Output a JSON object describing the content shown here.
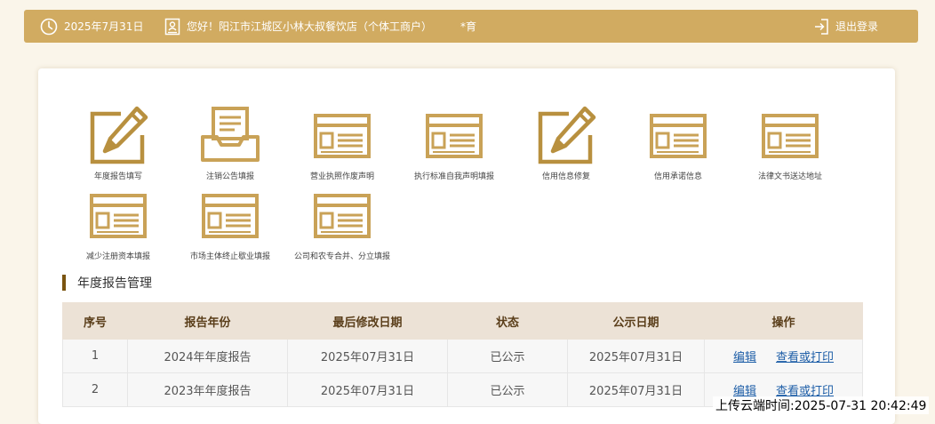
{
  "header": {
    "date": "2025年7月31日",
    "greeting": "您好！阳江市江城区小林大叔餐饮店（个体工商户）",
    "user": "*育",
    "logout_label": "退出登录"
  },
  "tiles": [
    {
      "label": "年度报告填写",
      "icon": "pencil-form-icon"
    },
    {
      "label": "注销公告填报",
      "icon": "inbox-tray-icon"
    },
    {
      "label": "营业执照作废声明",
      "icon": "document-window-icon"
    },
    {
      "label": "执行标准自我声明填报",
      "icon": "document-window-icon"
    },
    {
      "label": "信用信息修复",
      "icon": "pencil-form-icon"
    },
    {
      "label": "信用承诺信息",
      "icon": "document-window-icon"
    },
    {
      "label": "法律文书送达地址",
      "icon": "document-window-icon"
    },
    {
      "label": "减少注册资本填报",
      "icon": "document-window-icon"
    },
    {
      "label": "市场主体终止歇业填报",
      "icon": "document-window-icon"
    },
    {
      "label": "公司和农专合并、分立填报",
      "icon": "document-window-icon"
    }
  ],
  "section": {
    "title": "年度报告管理"
  },
  "table": {
    "headers": [
      "序号",
      "报告年份",
      "最后修改日期",
      "状态",
      "公示日期",
      "操作"
    ],
    "rows": [
      {
        "index": "1",
        "year": "2024年年度报告",
        "modified": "2025年07月31日",
        "status": "已公示",
        "public_date": "2025年07月31日",
        "edit": "编辑",
        "view": "查看或打印"
      },
      {
        "index": "2",
        "year": "2023年年度报告",
        "modified": "2025年07月31日",
        "status": "已公示",
        "public_date": "2025年07月31日",
        "edit": "编辑",
        "view": "查看或打印"
      }
    ]
  },
  "watermark": "上传云端时间:2025-07-31 20:42:49",
  "colors": {
    "header_bg": "#d1ab61",
    "icon_gold": "#c9a257",
    "section_bar": "#7a5410",
    "table_header_bg": "#ece2d6",
    "link": "#1f5fa8"
  }
}
